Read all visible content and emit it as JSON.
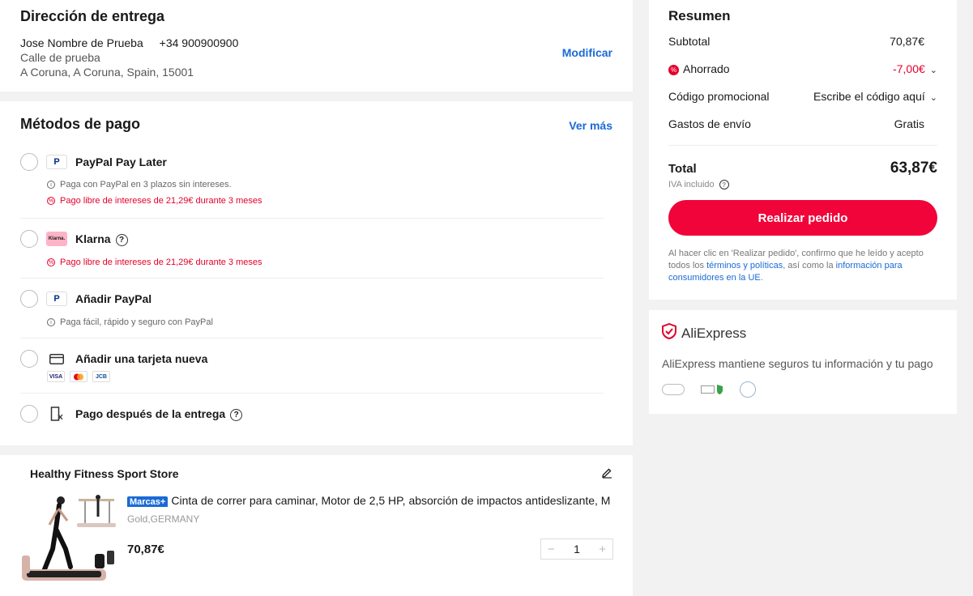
{
  "address": {
    "title": "Dirección de entrega",
    "name": "Jose Nombre de Prueba",
    "phone": "+34 900900900",
    "street": "Calle de prueba",
    "city": "A Coruna, A Coruna, Spain, 15001",
    "modify_label": "Modificar"
  },
  "payment": {
    "title": "Métodos de pago",
    "see_more": "Ver más",
    "methods": [
      {
        "label": "PayPal Pay Later",
        "icon": "paypal-icon",
        "notes": [
          "Paga con PayPal en 3 plazos sin intereses.",
          "Pago libre de intereses de 21,29€ durante 3 meses"
        ]
      },
      {
        "label": "Klarna",
        "icon": "klarna-icon",
        "icon_text": "Klarna.",
        "notes": [
          "Pago libre de intereses de 21,29€ durante 3 meses"
        ]
      },
      {
        "label": "Añadir PayPal",
        "icon": "paypal-icon",
        "notes": [
          "Paga fácil, rápido y seguro con PayPal"
        ]
      },
      {
        "label": "Añadir una tarjeta nueva",
        "icon": "credit-card-icon",
        "card_logos": [
          "VISA",
          "mastercard",
          "JCB"
        ]
      },
      {
        "label": "Pago después de la entrega",
        "icon": "cash-on-delivery-icon"
      }
    ]
  },
  "store": {
    "name": "Healthy Fitness Sport Store",
    "product": {
      "badge": "Marcas+",
      "title": "Cinta de correr para caminar, Motor de 2,5 HP, absorción de impactos antideslizante, M",
      "variant": "Gold,GERMANY",
      "price": "70,87€",
      "quantity": "1"
    }
  },
  "summary": {
    "title": "Resumen",
    "subtotal_label": "Subtotal",
    "subtotal_value": "70,87€",
    "saved_label": "Ahorrado",
    "saved_value": "-7,00€",
    "promo_label": "Código promocional",
    "promo_value": "Escribe el código aquí",
    "shipping_label": "Gastos de envío",
    "shipping_value": "Gratis",
    "total_label": "Total",
    "total_value": "63,87€",
    "iva_label": "IVA incluido",
    "order_button": "Realizar pedido",
    "legal_pre": "Al hacer clic en 'Realizar pedido', confirmo que he leído y acepto todos los ",
    "legal_link1": "términos y políticas",
    "legal_mid": ", así como la ",
    "legal_link2": "información para consumidores en la UE",
    "legal_post": ".",
    "accent_color": "#f0043a"
  },
  "security": {
    "brand": "AliExpress",
    "text": "AliExpress mantiene seguros tu información y tu pago"
  }
}
